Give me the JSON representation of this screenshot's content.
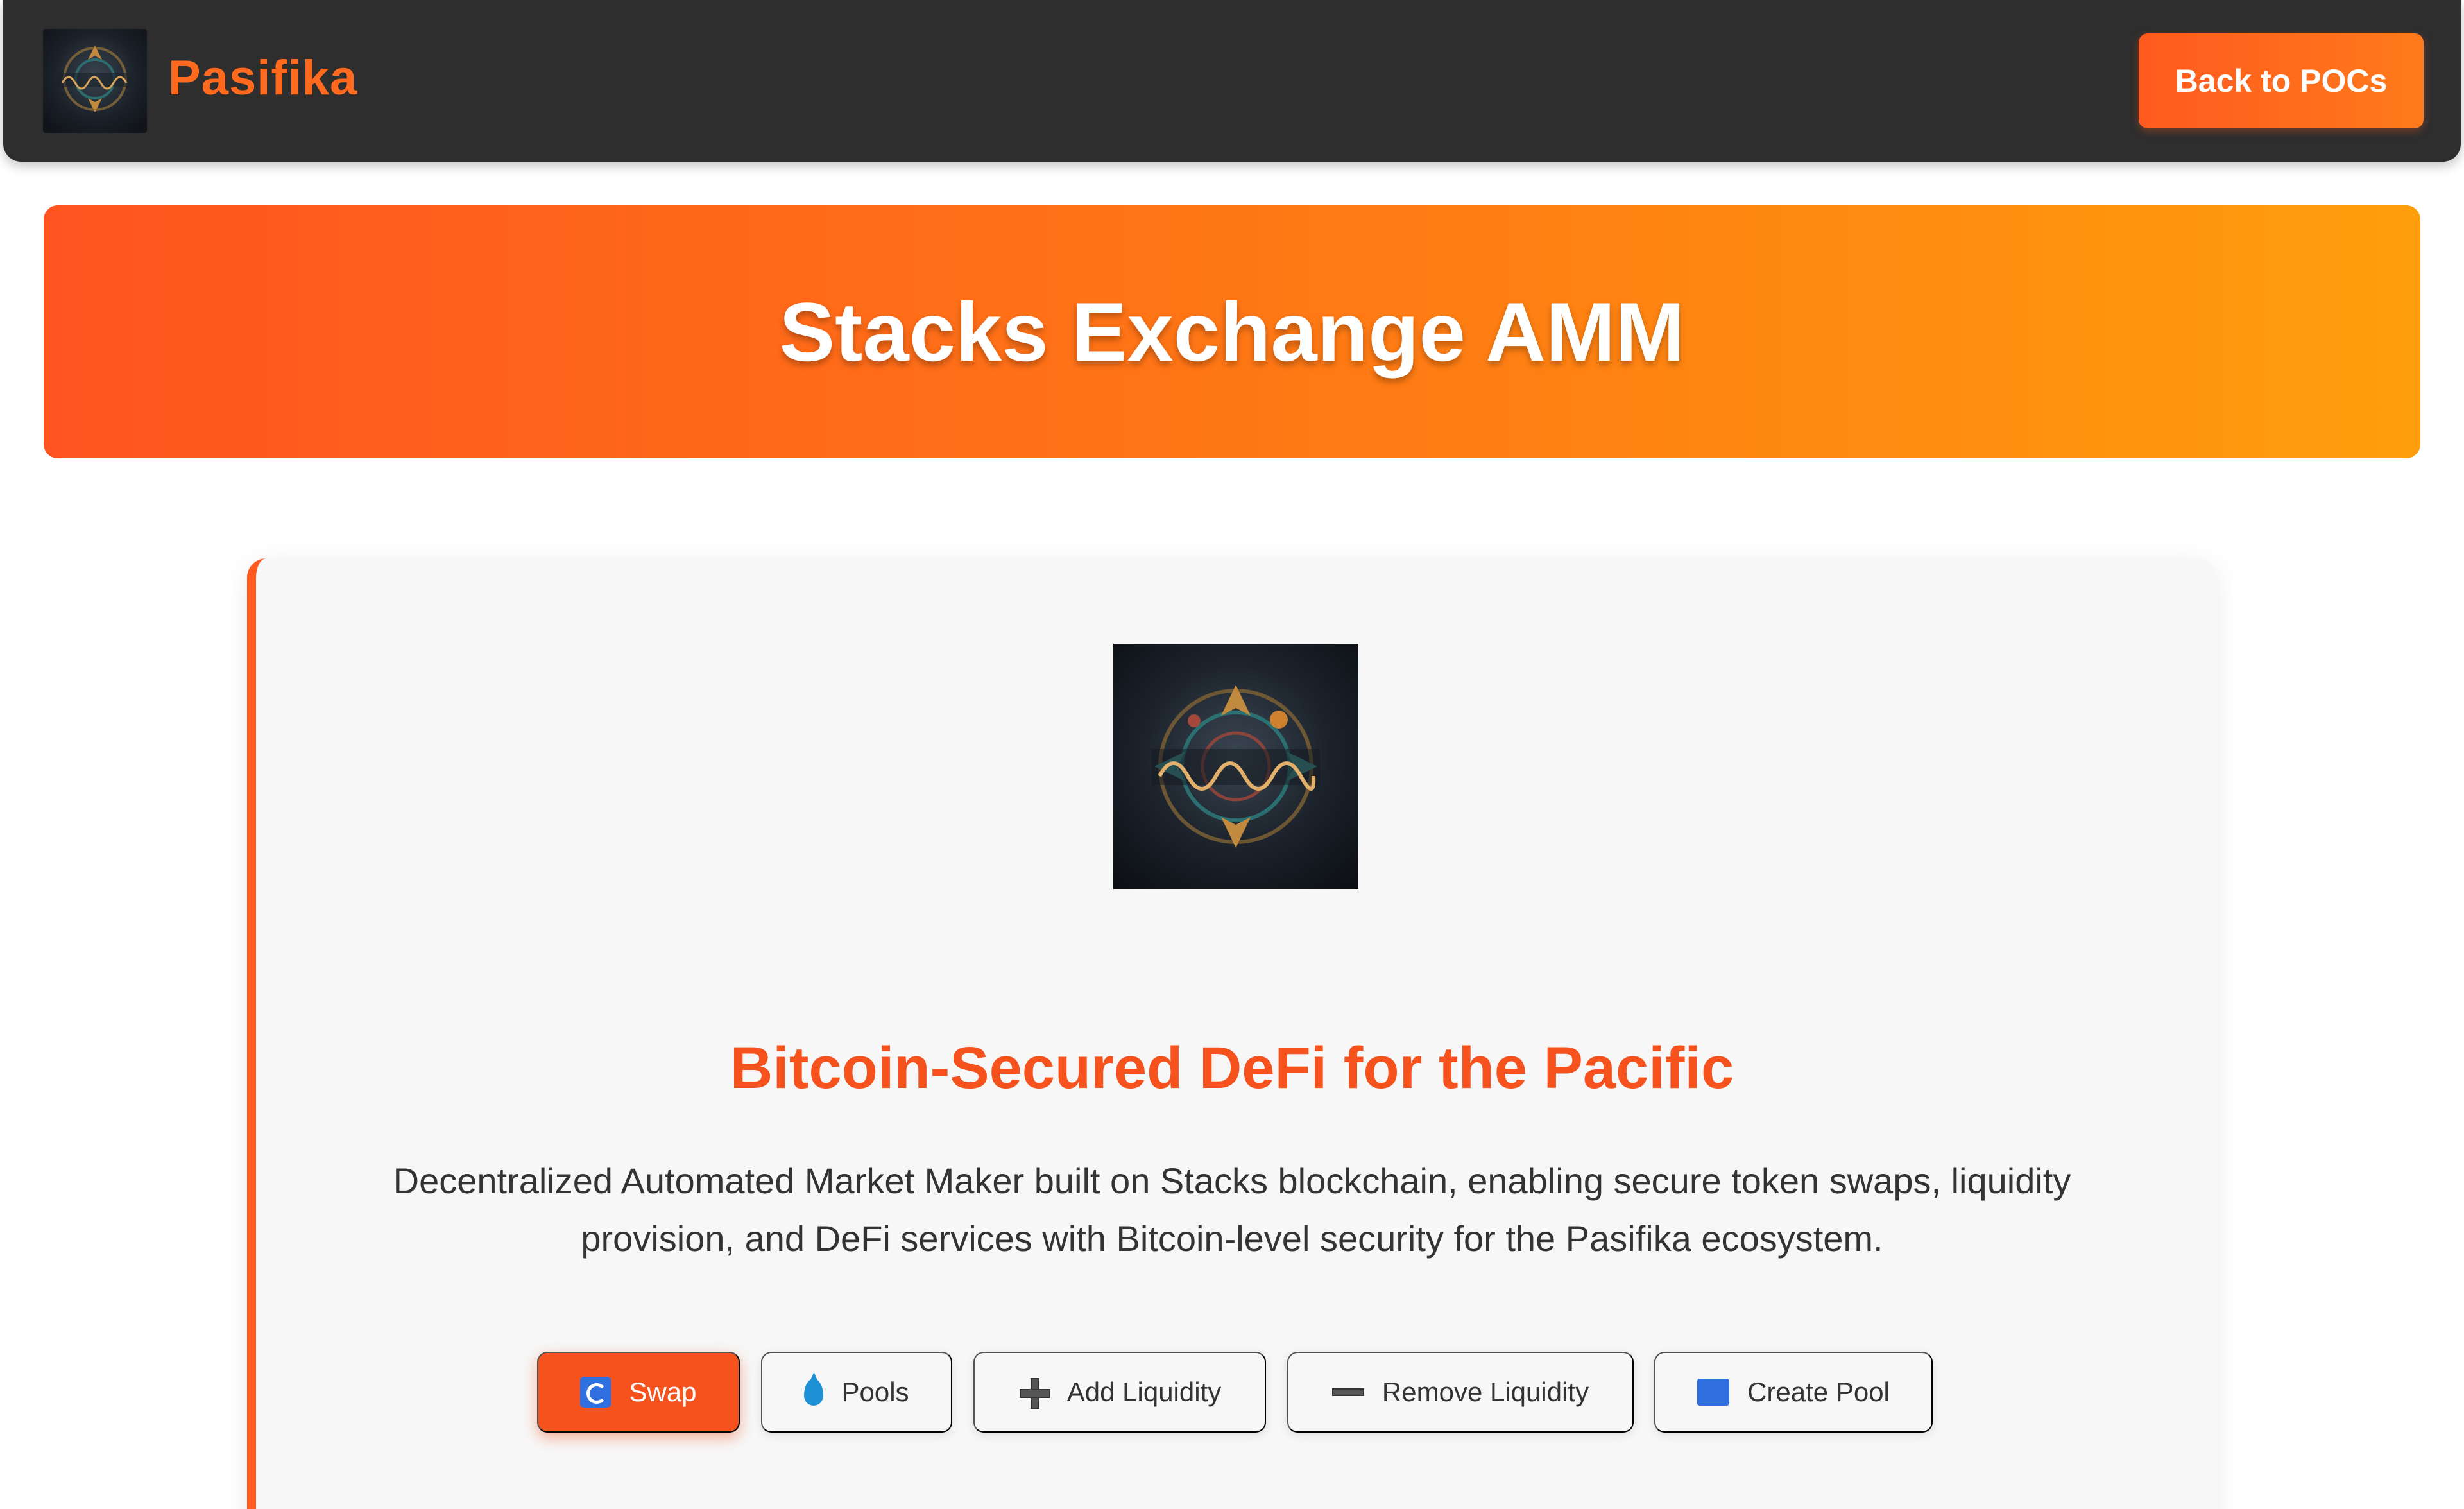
{
  "header": {
    "brand_name": "Pasifika",
    "back_button_label": "Back to POCs"
  },
  "hero": {
    "title": "Stacks Exchange AMM"
  },
  "card": {
    "title": "Bitcoin-Secured DeFi for the Pacific",
    "description": "Decentralized Automated Market Maker built on Stacks blockchain, enabling secure token swaps, liquidity provision, and DeFi services with Bitcoin-level security for the Pasifika ecosystem."
  },
  "tabs": [
    {
      "label": "Swap",
      "icon": "swap-icon",
      "active": true
    },
    {
      "label": "Pools",
      "icon": "droplet-icon",
      "active": false
    },
    {
      "label": "Add Liquidity",
      "icon": "plus-icon",
      "active": false
    },
    {
      "label": "Remove Liquidity",
      "icon": "minus-icon",
      "active": false
    },
    {
      "label": "Create Pool",
      "icon": "new-icon",
      "active": false
    }
  ],
  "colors": {
    "accent": "#f5521d",
    "header_bg": "#2e2e2e",
    "card_bg": "#f7f7f7"
  }
}
